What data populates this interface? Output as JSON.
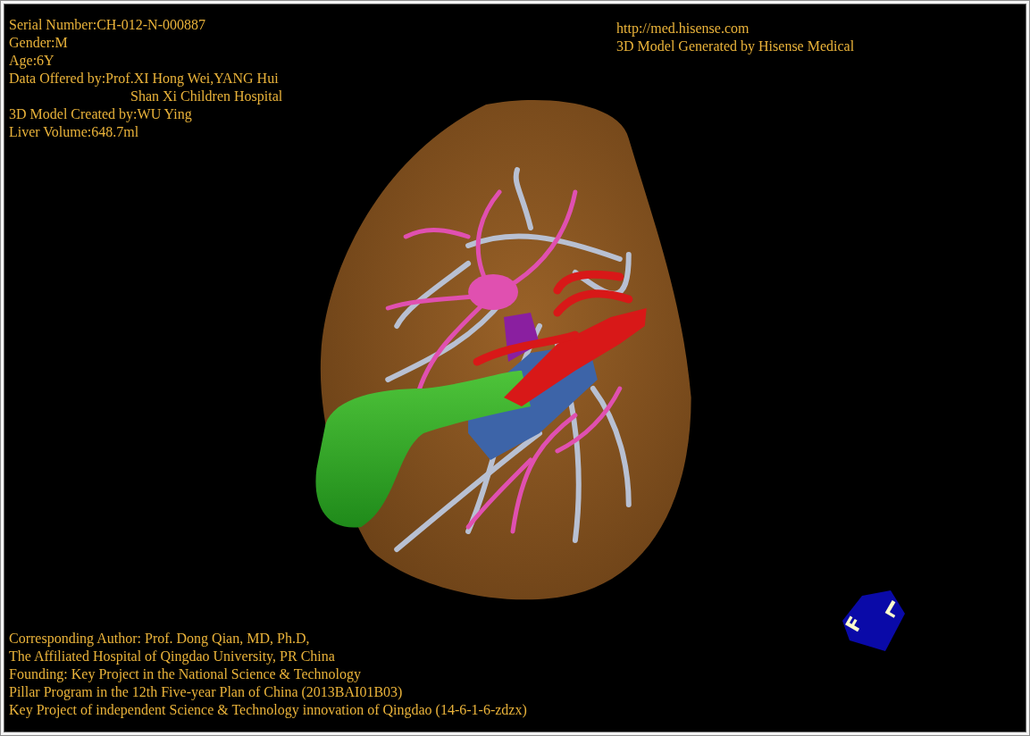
{
  "viewer": {
    "info_top_left": [
      {
        "text": "Serial Number:CH-012-N-000887",
        "kind": "line"
      },
      {
        "text": "Gender:M",
        "kind": "line"
      },
      {
        "text": "Age:6Y",
        "kind": "line"
      },
      {
        "text": "Data Offered by:Prof.XI Hong Wei,YANG Hui",
        "kind": "line"
      },
      {
        "text": "Shan Xi Children Hospital",
        "kind": "continuation"
      },
      {
        "text": "3D Model Created by:WU Ying",
        "kind": "line"
      },
      {
        "text": "Liver Volume:648.7ml",
        "kind": "line"
      }
    ],
    "info_top_right": [
      "http://med.hisense.com",
      "3D Model Generated by Hisense Medical"
    ],
    "info_bottom": [
      "Corresponding Author: Prof. Dong Qian, MD, Ph.D,",
      "The Affiliated Hospital of Qingdao University, PR China",
      "Founding: Key Project in the National Science & Technology",
      "Pillar Program in the 12th Five-year Plan of China (2013BAI01B03)",
      "Key Project of independent Science & Technology innovation of Qingdao (14-6-1-6-zdzx)"
    ],
    "orientation_cube": {
      "faces": [
        "F",
        "L"
      ]
    }
  }
}
